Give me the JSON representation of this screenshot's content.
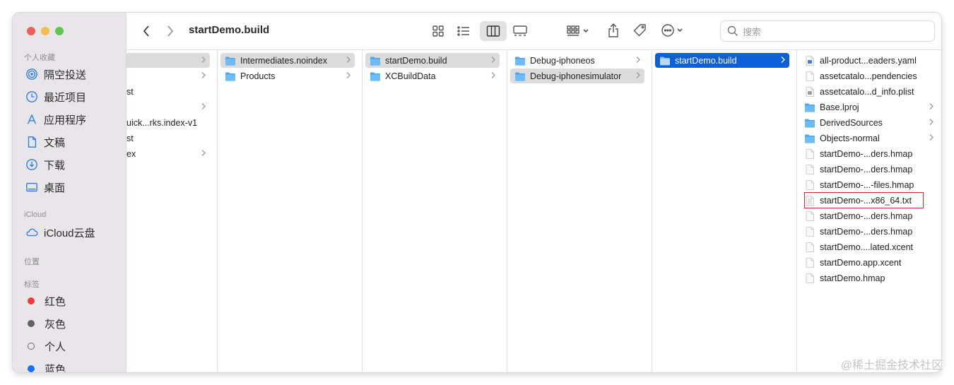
{
  "window": {
    "title": "startDemo.build"
  },
  "sidebar": {
    "favorites_header": "个人收藏",
    "favorites": [
      {
        "label": "隔空投送",
        "icon": "airdrop-icon"
      },
      {
        "label": "最近项目",
        "icon": "clock-icon"
      },
      {
        "label": "应用程序",
        "icon": "applications-icon"
      },
      {
        "label": "文稿",
        "icon": "document-icon"
      },
      {
        "label": "下载",
        "icon": "download-icon"
      },
      {
        "label": "桌面",
        "icon": "desktop-icon"
      }
    ],
    "icloud_header": "iCloud",
    "icloud": [
      {
        "label": "iCloud云盘",
        "icon": "cloud-icon"
      }
    ],
    "locations_header": "位置",
    "tags_header": "标签",
    "tags": [
      {
        "label": "红色",
        "color": "#f2393a"
      },
      {
        "label": "灰色",
        "color": "#616161"
      },
      {
        "label": "个人",
        "color": "hollow"
      },
      {
        "label": "蓝色",
        "color": "#1670f7"
      }
    ]
  },
  "search": {
    "placeholder": "搜索"
  },
  "columns": [
    {
      "items": [
        {
          "label": "",
          "type": "folder",
          "chevron": true,
          "state": "selected"
        },
        {
          "label": "",
          "type": "folder",
          "chevron": true
        },
        {
          "label": "st",
          "type": "file"
        },
        {
          "label": "",
          "type": "folder",
          "chevron": true
        },
        {
          "label": "uick...rks.index-v1",
          "type": "file"
        },
        {
          "label": "st",
          "type": "file"
        },
        {
          "label": "ex",
          "type": "folder",
          "chevron": true
        }
      ]
    },
    {
      "items": [
        {
          "label": "Intermediates.noindex",
          "type": "folder",
          "chevron": true,
          "state": "selected"
        },
        {
          "label": "Products",
          "type": "folder",
          "chevron": true
        }
      ]
    },
    {
      "items": [
        {
          "label": "startDemo.build",
          "type": "folder",
          "chevron": true,
          "state": "selected"
        },
        {
          "label": "XCBuildData",
          "type": "folder",
          "chevron": true
        }
      ]
    },
    {
      "items": [
        {
          "label": "Debug-iphoneos",
          "type": "folder",
          "chevron": true
        },
        {
          "label": "Debug-iphonesimulator",
          "type": "folder",
          "chevron": true,
          "state": "selected"
        }
      ]
    },
    {
      "items": [
        {
          "label": "startDemo.build",
          "type": "folder",
          "chevron": true,
          "state": "active"
        }
      ]
    },
    {
      "items": [
        {
          "label": "all-product...eaders.yaml",
          "type": "yaml"
        },
        {
          "label": "assetcatalo...pendencies",
          "type": "file"
        },
        {
          "label": "assetcatalo...d_info.plist",
          "type": "plist"
        },
        {
          "label": "Base.lproj",
          "type": "folder",
          "chevron": true
        },
        {
          "label": "DerivedSources",
          "type": "folder",
          "chevron": true
        },
        {
          "label": "Objects-normal",
          "type": "folder",
          "chevron": true
        },
        {
          "label": "startDemo-...ders.hmap",
          "type": "file"
        },
        {
          "label": "startDemo-...ders.hmap",
          "type": "file"
        },
        {
          "label": "startDemo-...-files.hmap",
          "type": "file"
        },
        {
          "label": "startDemo-...x86_64.txt",
          "type": "text",
          "highlight": true
        },
        {
          "label": "startDemo-...ders.hmap",
          "type": "file"
        },
        {
          "label": "startDemo-...ders.hmap",
          "type": "file"
        },
        {
          "label": "startDemo....lated.xcent",
          "type": "file"
        },
        {
          "label": "startDemo.app.xcent",
          "type": "file"
        },
        {
          "label": "startDemo.hmap",
          "type": "file"
        }
      ]
    }
  ],
  "watermark": "@稀土掘金技术社区"
}
